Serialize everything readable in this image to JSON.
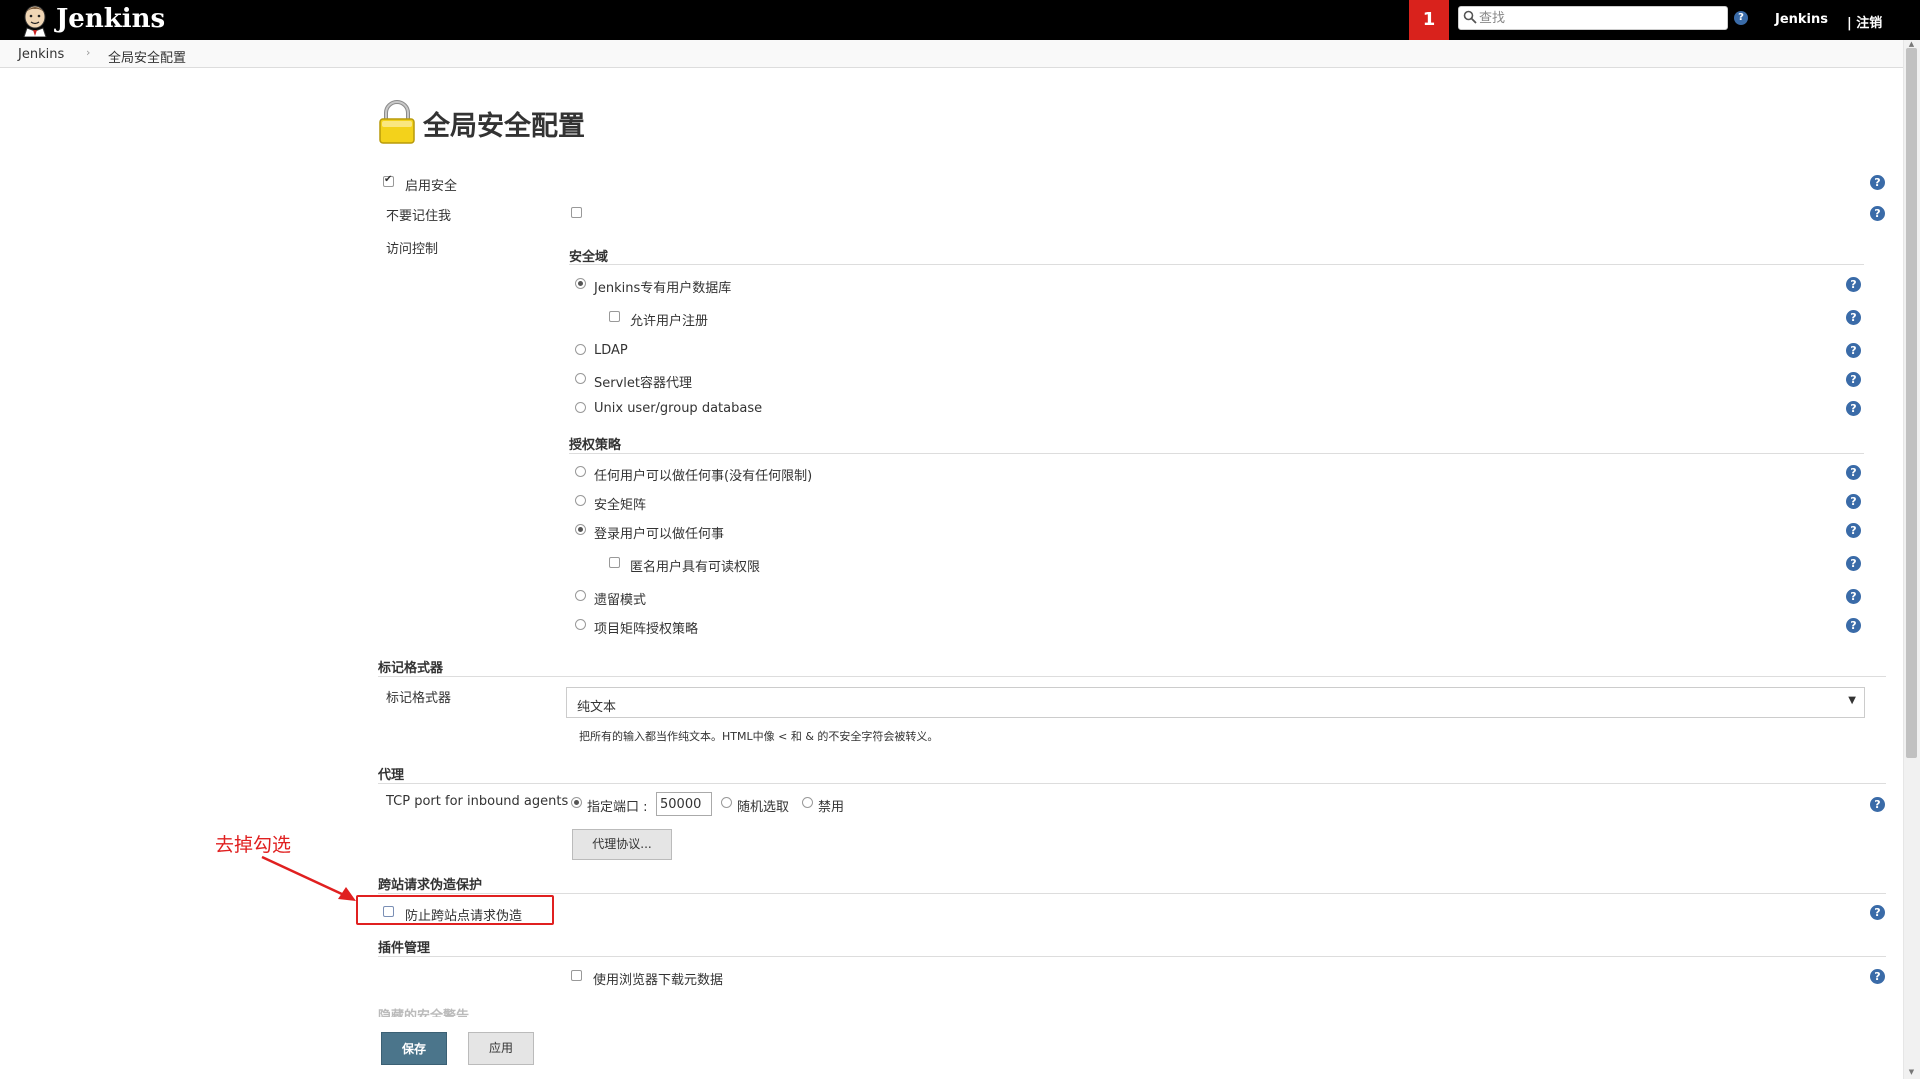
{
  "header": {
    "brand": "Jenkins",
    "notification_count": "1",
    "search_placeholder": "查找",
    "username": "Jenkins",
    "logout": "| 注销"
  },
  "breadcrumb": {
    "home": "Jenkins",
    "separator": "›",
    "current": "全局安全配置"
  },
  "page": {
    "title": "全局安全配置"
  },
  "security": {
    "enable_label": "启用安全",
    "enable_checked": true,
    "remember_me_label": "不要记住我",
    "remember_me_checked": false,
    "access_control_label": "访问控制",
    "realm_section": "安全域",
    "realm_options": [
      {
        "label": "Jenkins专有用户数据库",
        "checked": true
      },
      {
        "label": "LDAP",
        "checked": false
      },
      {
        "label": "Servlet容器代理",
        "checked": false
      },
      {
        "label": "Unix user/group database",
        "checked": false
      }
    ],
    "allow_signup_label": "允许用户注册",
    "allow_signup_checked": false,
    "authz_section": "授权策略",
    "authz_options": [
      {
        "label": "任何用户可以做任何事(没有任何限制)",
        "checked": false
      },
      {
        "label": "安全矩阵",
        "checked": false
      },
      {
        "label": "登录用户可以做任何事",
        "checked": true
      },
      {
        "label": "遗留模式",
        "checked": false
      },
      {
        "label": "项目矩阵授权策略",
        "checked": false
      }
    ],
    "anon_read_label": "匿名用户具有可读权限",
    "anon_read_checked": false
  },
  "markup": {
    "section": "标记格式器",
    "label": "标记格式器",
    "selected": "纯文本",
    "description": "把所有的输入都当作纯文本。HTML中像 < 和 & 的不安全字符会被转义。"
  },
  "agents": {
    "section": "代理",
    "tcp_label": "TCP port for inbound agents",
    "fixed_label": "指定端口 :",
    "fixed_checked": true,
    "port_value": "50000",
    "random_label": "随机选取",
    "random_checked": false,
    "disable_label": "禁用",
    "disable_checked": false,
    "protocols_button": "代理协议..."
  },
  "csrf": {
    "section": "跨站请求伪造保护",
    "label": "防止跨站点请求伪造",
    "checked": false
  },
  "plugins": {
    "section": "插件管理",
    "label": "使用浏览器下载元数据",
    "checked": false
  },
  "hidden_warnings": {
    "section": "隐藏的安全警告"
  },
  "buttons": {
    "save": "保存",
    "apply": "应用"
  },
  "annotation": {
    "text": "去掉勾选",
    "color": "#e02020"
  },
  "colors": {
    "topbar": "#000000",
    "notification": "#d9221c",
    "save_button": "#4b758b",
    "help_icon": "#3a6ba8"
  }
}
